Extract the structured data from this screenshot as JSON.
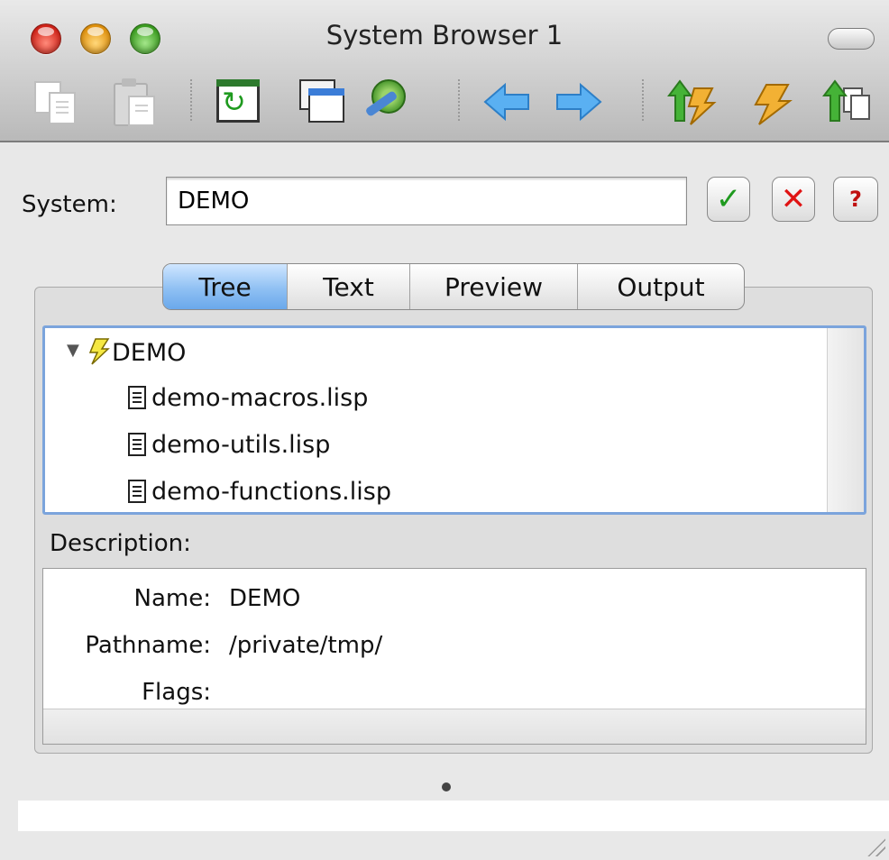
{
  "window": {
    "title": "System Browser 1"
  },
  "toolbar": {
    "items": [
      {
        "name": "copy-icon"
      },
      {
        "name": "paste-icon"
      },
      {
        "name": "refresh-icon"
      },
      {
        "name": "new-window-icon"
      },
      {
        "name": "settings-tool-icon"
      },
      {
        "name": "back-arrow-icon"
      },
      {
        "name": "forward-arrow-icon"
      },
      {
        "name": "system-up-icon"
      },
      {
        "name": "system-icon"
      },
      {
        "name": "load-up-icon"
      }
    ]
  },
  "system": {
    "label": "System:",
    "value": "DEMO",
    "ok_icon": "✓",
    "cancel_icon": "✕",
    "help_icon": "?"
  },
  "tabs": [
    {
      "label": "Tree",
      "active": true
    },
    {
      "label": "Text",
      "active": false
    },
    {
      "label": "Preview",
      "active": false
    },
    {
      "label": "Output",
      "active": false
    }
  ],
  "tree": {
    "root": "DEMO",
    "children": [
      "demo-macros.lisp",
      "demo-utils.lisp",
      "demo-functions.lisp"
    ]
  },
  "description": {
    "label": "Description:",
    "fields": [
      {
        "key": "Name:",
        "value": "DEMO"
      },
      {
        "key": "Pathname:",
        "value": "/private/tmp/"
      },
      {
        "key": "Flags:",
        "value": ""
      }
    ]
  },
  "colors": {
    "accent": "#6aa8eb",
    "tree_border": "#7ba4dc"
  }
}
